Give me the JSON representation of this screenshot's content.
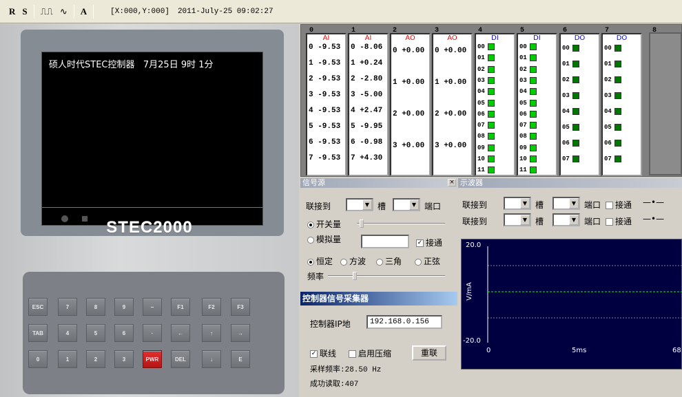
{
  "toolbar": {
    "r": "R",
    "s": "S",
    "pulse": "⎍⎍",
    "wave": "∿",
    "a": "A",
    "coords": "[X:000,Y:000]",
    "datetime": "2011-July-25 09:02:27"
  },
  "device": {
    "lcd_title": "硕人时代STEC控制器   7月25日 9时 1分",
    "brand": "STEC2000",
    "keys": [
      [
        "ESC",
        "7",
        "8",
        "9",
        "−",
        "F1",
        "F2",
        "F3"
      ],
      [
        "TAB",
        "4",
        "5",
        "6",
        "·",
        "←",
        "↑",
        "→"
      ],
      [
        "0",
        "1",
        "2",
        "3",
        "PWR",
        "DEL",
        "↓",
        "E"
      ]
    ]
  },
  "io": {
    "slots": [
      "0",
      "1",
      "2",
      "3",
      "4",
      "5",
      "6",
      "7",
      "8"
    ],
    "cards": [
      {
        "type": "AI",
        "rows": [
          "0 -9.53",
          "1 -9.53",
          "2 -9.53",
          "3 -9.53",
          "4 -9.53",
          "5 -9.53",
          "6 -9.53",
          "7 -9.53"
        ]
      },
      {
        "type": "AI",
        "rows": [
          "0 -8.06",
          "1 +0.24",
          "2 -2.80",
          "3 -5.00",
          "4 +2.47",
          "5 -9.95",
          "6 -0.98",
          "7 +4.30"
        ]
      },
      {
        "type": "AO",
        "rows": [
          "0 +0.00",
          "1 +0.00",
          "2 +0.00",
          "3 +0.00"
        ]
      },
      {
        "type": "AO",
        "rows": [
          "0 +0.00",
          "1 +0.00",
          "2 +0.00",
          "3 +0.00"
        ]
      },
      {
        "type": "DI",
        "bits": [
          "00",
          "01",
          "02",
          "03",
          "04",
          "05",
          "06",
          "07",
          "08",
          "09",
          "10",
          "11"
        ]
      },
      {
        "type": "DI",
        "bits": [
          "00",
          "01",
          "02",
          "03",
          "04",
          "05",
          "06",
          "07",
          "08",
          "09",
          "10",
          "11"
        ]
      },
      {
        "type": "DO",
        "bits": [
          "00",
          "01",
          "02",
          "03",
          "04",
          "05",
          "06",
          "07"
        ]
      },
      {
        "type": "DO",
        "bits": [
          "00",
          "01",
          "02",
          "03",
          "04",
          "05",
          "06",
          "07"
        ]
      }
    ]
  },
  "signal_source": {
    "title": "信号源",
    "close": "×",
    "connect_to": "联接到",
    "slot": "槽",
    "port": "端口",
    "switch_qty": "开关量",
    "analog_qty": "模拟量",
    "connect": "接通",
    "constant": "恒定",
    "square": "方波",
    "triangle": "三角",
    "sine": "正弦",
    "frequency": "频率"
  },
  "acquisition": {
    "title": "控制器信号采集器",
    "ip_label": "控制器IP地",
    "ip_value": "192.168.0.156",
    "online": "联线",
    "compress": "启用压缩",
    "reconnect": "重联",
    "sample_rate": "采样频率:28.50 Hz",
    "read_ok": "成功读取:407"
  },
  "scope": {
    "title": "示波器",
    "connect_to": "联接到",
    "slot": "槽",
    "port": "端口",
    "connect": "接通",
    "ymax": "20.0",
    "ymin": "-20.0",
    "ylabel": "V/mA",
    "x0": "0",
    "x1": "5ms",
    "x2": "68",
    "colors": {
      "bg": "#000040",
      "trace": "#00ff00"
    }
  }
}
